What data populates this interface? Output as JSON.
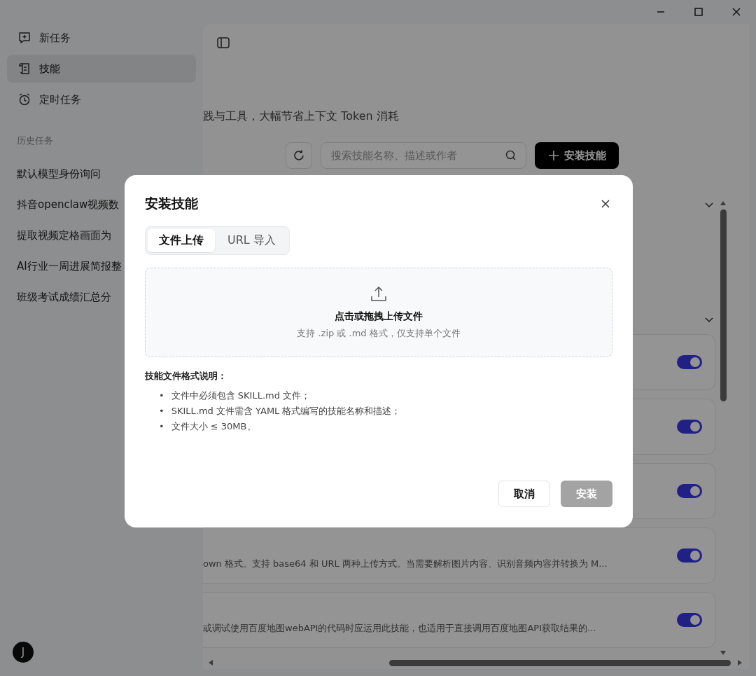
{
  "sidebar": {
    "nav": [
      {
        "label": "新任务",
        "selected": false
      },
      {
        "label": "技能",
        "selected": true
      },
      {
        "label": "定时任务",
        "selected": false
      }
    ],
    "history_heading": "历史任务",
    "history": [
      "默认模型身份询问",
      "抖音openclaw视频数",
      "提取视频定格画面为",
      "AI行业一周进展简报整",
      "班级考试成绩汇总分"
    ],
    "avatar": "J"
  },
  "main": {
    "subtitle": "践与工具，大幅节省上下文 Token 消耗",
    "search": {
      "placeholder": "搜索技能名称、描述或作者"
    },
    "install_button": "安装技能",
    "skills": [
      {
        "on": true
      },
      {
        "on": true
      },
      {
        "on": true
      },
      {
        "description": "own 格式。支持 base64 和 URL 两种上传方式。当需要解析图片内容、识别音频内容并转换为 M...",
        "on": true
      },
      {
        "description": "或调试使用百度地图webAPI的代码时应运用此技能，也适用于直接调用百度地图API获取结果的...",
        "on": true
      }
    ]
  },
  "dialog": {
    "title": "安装技能",
    "tabs": [
      {
        "label": "文件上传",
        "selected": true
      },
      {
        "label": "URL 导入",
        "selected": false
      }
    ],
    "dropzone": {
      "title": "点击或拖拽上传文件",
      "hint": "支持 .zip 或 .md 格式，仅支持单个文件"
    },
    "notes": {
      "heading": "技能文件格式说明：",
      "marker": "•",
      "items": [
        "文件中必须包含 SKILL.md 文件；",
        "SKILL.md 文件需含 YAML 格式编写的技能名称和描述；",
        "文件大小 ≤ 30MB。"
      ]
    },
    "cancel": "取消",
    "install": {
      "label": "安装",
      "disabled": true
    }
  }
}
